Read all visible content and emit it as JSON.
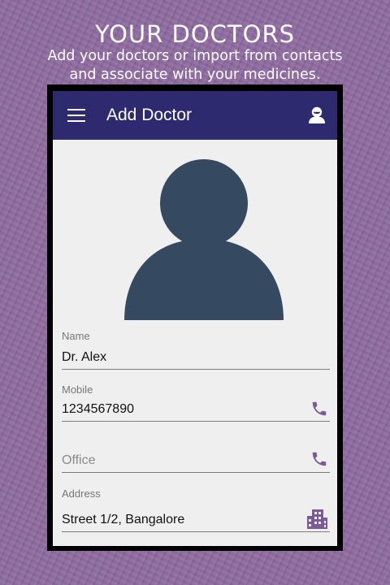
{
  "promo": {
    "title": "YOUR DOCTORS",
    "subtitle_line1": "Add your doctors or import from contacts",
    "subtitle_line2": "and associate with your medicines."
  },
  "appbar": {
    "title": "Add Doctor",
    "menu_icon": "hamburger-menu-icon",
    "profile_icon": "person-icon"
  },
  "form": {
    "name": {
      "label": "Name",
      "value": "Dr. Alex"
    },
    "mobile": {
      "label": "Mobile",
      "value": "1234567890",
      "icon": "phone-icon"
    },
    "office": {
      "placeholder": "Office",
      "icon": "phone-icon"
    },
    "address": {
      "label": "Address",
      "value": "Street 1/2, Bangalore",
      "icon": "building-icon"
    }
  },
  "colors": {
    "background": "#8e6aa0",
    "appbar": "#2e2a70",
    "avatar": "#354a60",
    "icon_accent": "#7a5a98"
  }
}
